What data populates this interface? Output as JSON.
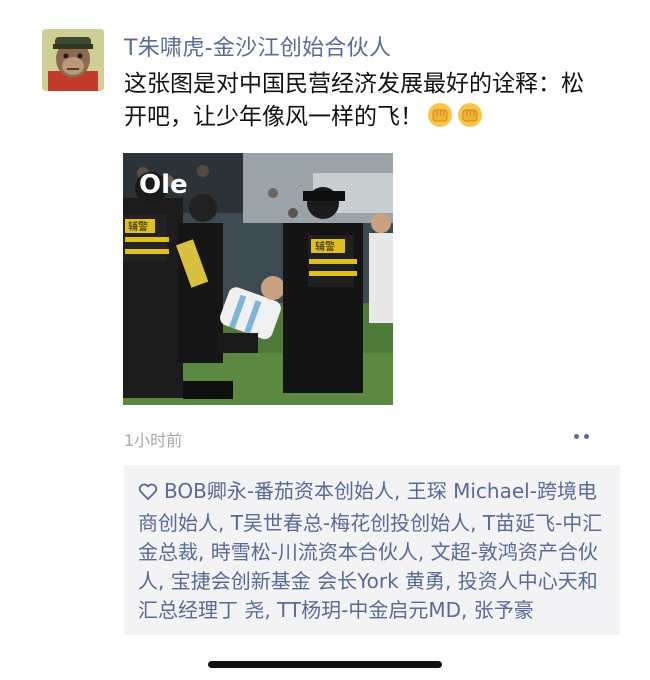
{
  "moment": {
    "author": "T朱啸虎-金沙江创始合伙人",
    "text": "这张图是对中国民营经济发展最好的诠释：松开吧，让少年像风一样的飞！",
    "emojis": [
      "fist-emoji",
      "fist-emoji"
    ],
    "photo": {
      "watermark": "Ole",
      "vest_text_left": "辅警",
      "vest_text_right": "辅警"
    },
    "time": "1小时前",
    "likes_text": "BOB卿永-番茄资本创始人, 王琛 Michael-跨境电商创始人, T吴世春总-梅花创投创始人, T苗延飞-中汇金总裁, 時雪松-川流资本合伙人, 文超-敦鸿资产合伙人, 宝捷会创新基金 会长York 黄勇, 投资人中心天和汇总经理丁 尧, TT杨玥-中金启元MD, 张予豪"
  },
  "colors": {
    "link": "#576b95",
    "time": "#a8a8a8",
    "likes_bg": "#f3f3f5"
  }
}
